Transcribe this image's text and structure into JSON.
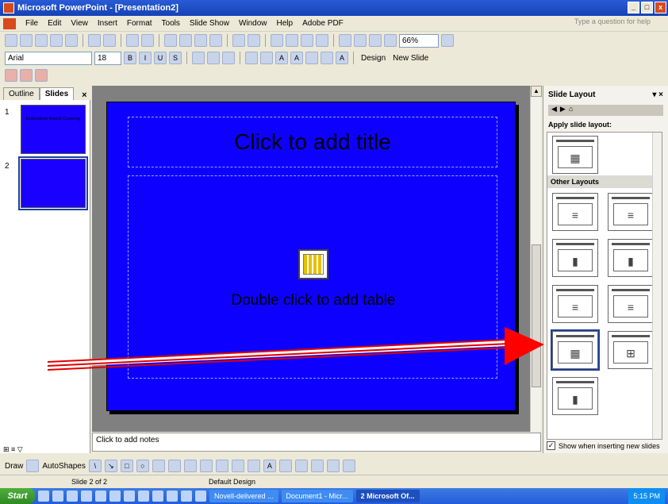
{
  "window": {
    "title": "Microsoft PowerPoint - [Presentation2]"
  },
  "menu": {
    "items": [
      "File",
      "Edit",
      "View",
      "Insert",
      "Format",
      "Tools",
      "Slide Show",
      "Window",
      "Help",
      "Adobe PDF"
    ],
    "help_placeholder": "Type a question for help"
  },
  "toolbar": {
    "zoom": "66%",
    "font": "Arial",
    "font_size": "18",
    "design_label": "Design",
    "new_slide_label": "New Slide"
  },
  "outline_tabs": {
    "outline": "Outline",
    "slides": "Slides"
  },
  "thumbnails": [
    {
      "num": "1",
      "text": "Explorations Around Clustering"
    },
    {
      "num": "2",
      "text": ""
    }
  ],
  "slide": {
    "title_placeholder": "Click to add title",
    "body_placeholder": "Double click to add table"
  },
  "notes": {
    "placeholder": "Click to add notes"
  },
  "task_pane": {
    "title": "Slide Layout",
    "apply_label": "Apply slide layout:",
    "other_layouts": "Other Layouts",
    "show_when_inserting": "Show when inserting new slides"
  },
  "draw_toolbar": {
    "draw": "Draw",
    "autoshapes": "AutoShapes"
  },
  "status": {
    "slide": "Slide 2 of 2",
    "design": "Default Design"
  },
  "taskbar": {
    "start": "Start",
    "tasks": [
      "Novell-delivered ...",
      "Document1 - Micr...",
      "2 Microsoft Of..."
    ],
    "clock": "5:15 PM"
  }
}
